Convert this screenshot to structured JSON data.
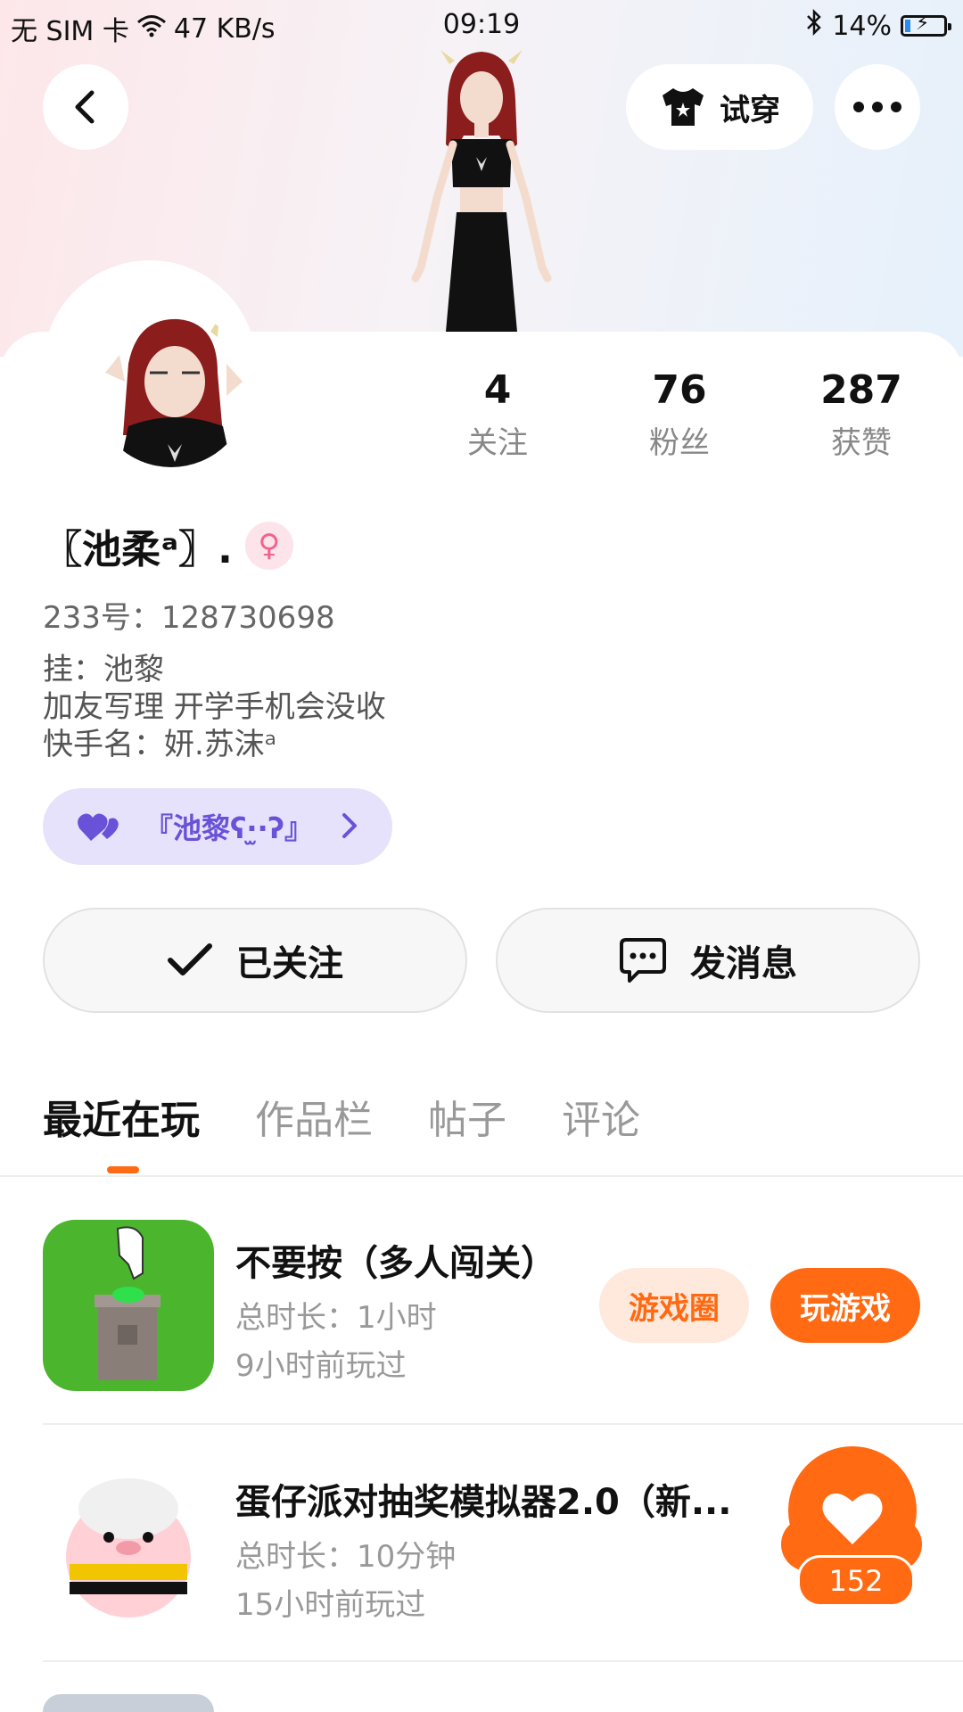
{
  "status_bar": {
    "carrier": "无 SIM 卡",
    "speed": "47 KB/s",
    "time": "09:19",
    "battery": "14%",
    "battery_level": 0.14
  },
  "header": {
    "tryon_label": "试穿"
  },
  "profile": {
    "stats": [
      {
        "value": "4",
        "label": "关注"
      },
      {
        "value": "76",
        "label": "粉丝"
      },
      {
        "value": "287",
        "label": "获赞"
      }
    ],
    "name": "〖池柔ᵃ〗.",
    "gender_icon": "female-icon",
    "uid": "233号：128730698",
    "bio": [
      "挂：池黎",
      "加友写理 开学手机会没收",
      "快手名：妍.苏沫ᵃ"
    ],
    "tag": "『池黎ʕ·̫·ʔ』"
  },
  "actions": {
    "follow_label": "已关注",
    "message_label": "发消息"
  },
  "tabs": [
    "最近在玩",
    "作品栏",
    "帖子",
    "评论"
  ],
  "games": [
    {
      "title": "不要按（多人闯关）",
      "duration": "总时长：1小时",
      "last_played": "9小时前玩过",
      "circle_label": "游戏圈",
      "play_label": "玩游戏"
    },
    {
      "title": "蛋仔派对抽奖模拟器2.0（新...",
      "duration": "总时长：10分钟",
      "last_played": "15小时前玩过"
    }
  ],
  "like_count": "152",
  "colors": {
    "accent": "#ff6a13",
    "tag_bg": "#e6e2fb",
    "tag_text": "#6a52d8"
  }
}
